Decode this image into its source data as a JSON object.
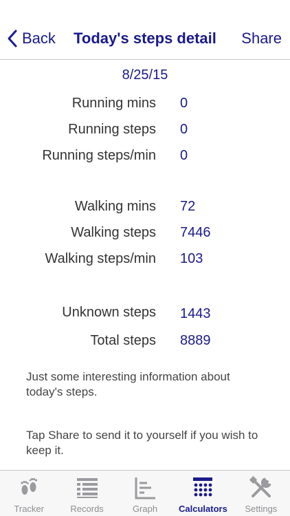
{
  "nav": {
    "back_label": "Back",
    "title": "Today's steps detail",
    "share_label": "Share"
  },
  "date": "8/25/15",
  "running": [
    {
      "label": "Running mins",
      "value": "0"
    },
    {
      "label": "Running steps",
      "value": "0"
    },
    {
      "label": "Running steps/min",
      "value": "0"
    }
  ],
  "walking": [
    {
      "label": "Walking mins",
      "value": "72"
    },
    {
      "label": "Walking steps",
      "value": "7446"
    },
    {
      "label": "Walking steps/min",
      "value": "103"
    }
  ],
  "totals": [
    {
      "label": "Unknown steps",
      "value": "1443"
    },
    {
      "label": "Total steps",
      "value": "8889"
    }
  ],
  "notes": {
    "info": "Just some interesting information about today's steps.",
    "share_hint": "Tap Share to send it to yourself if you wish to keep it."
  },
  "tabs": [
    {
      "label": "Tracker",
      "icon": "footprints-icon"
    },
    {
      "label": "Records",
      "icon": "list-icon"
    },
    {
      "label": "Graph",
      "icon": "graph-icon"
    },
    {
      "label": "Calculators",
      "icon": "calculator-icon",
      "active": true
    },
    {
      "label": "Settings",
      "icon": "tools-icon"
    }
  ],
  "colors": {
    "accent": "#1a1a8c",
    "inactive_tab": "#8e8e93"
  }
}
